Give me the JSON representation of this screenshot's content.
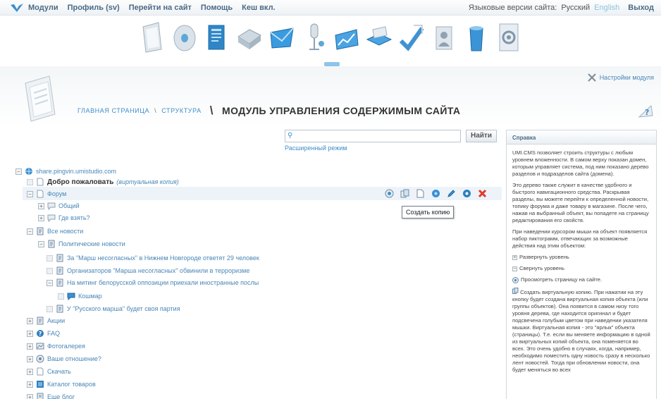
{
  "topnav": {
    "items": [
      "Модули",
      "Профиль (sv)",
      "Перейти на сайт",
      "Помощь",
      "Кеш вкл."
    ],
    "lang_label": "Языковые версии сайта:",
    "lang_current": "Русский",
    "lang_other": "English",
    "exit": "Выход"
  },
  "header": {
    "crumb_home": "ГЛАВНАЯ СТРАНИЦА",
    "crumb_sep": "\\",
    "crumb_struct": "СТРУКТУРА",
    "crumb_big_sep": "\\",
    "title": "МОДУЛЬ УПРАВЛЕНИЯ СОДЕРЖИМЫМ САЙТА",
    "settings": "Настройки модуля"
  },
  "search": {
    "value": "",
    "button": "Найти",
    "advanced": "Расширенный режим"
  },
  "tree": {
    "root": "share.pingvin.umistudio.com",
    "welcome": "Добро пожаловать",
    "welcome_note": "(виртуальная копия)",
    "forum": "Форум",
    "general": "Общий",
    "where": "Где взять?",
    "all_news": "Все новости",
    "politics": "Политические новости",
    "n1": "За \"Марш несогласных\" в Нижнем Новгороде ответят 29 человек",
    "n2": "Организаторов \"Марша несогласных\" обвинили в терроризме",
    "n3": "На митинг белорусской оппозиции приехали иностранные послы",
    "nightmare": "Кошмар",
    "n4": "У \"Русского марша\" будет своя партия",
    "promo": "Акции",
    "faq": "FAQ",
    "gallery": "Фотогалерея",
    "poll": "Ваше отношение?",
    "download": "Скачать",
    "catalog": "Каталог товаров",
    "blog": "Еще блог"
  },
  "tooltip": "Создать копию",
  "help": {
    "title": "Справка",
    "p1": "UMI.CMS позволяет строить структуры с любым уровнем вложенности. В самом верху показан домен, которым управляет система, под ним показано дерево разделов и подразделов сайта (домена).",
    "p2": "Это дерево также служит в качестве удобного и быстрого навигационного средства. Раскрывая разделы, вы можете перейти к определенной новости, топику форума и даже товару в магазине. После чего, нажав на выбранный объект, вы попадете на страницу редактирования его свойств.",
    "p3": "При наведении курсором мыши на объект появляется набор пиктограмм, отвечающих за возможные действия над этим объектом:",
    "expand": "Развернуть уровень",
    "collapse": "Свернуть уровень",
    "view": "Просмотреть страницу на сайте.",
    "p4": "Создать виртуальную копию. При нажатии на эту кнопку будет создана виртуальная копия объекта (или группы объектов). Она появится в самом низу того уровня дерева, где находится оригинал и будет подсвечена голубым цветом при наведении указателя мышки. Виртуальная копия - это \"ярлык\" объекта (страницы). Т.е. если вы меняете информацию в одной из виртуальных копий объекта, она поменяется во всех. Это очень удобно в случаях, когда, например, необходимо поместить одну новость сразу в несколько лент новостей. Тогда при обновлении новости, она будет меняться во всех"
  }
}
